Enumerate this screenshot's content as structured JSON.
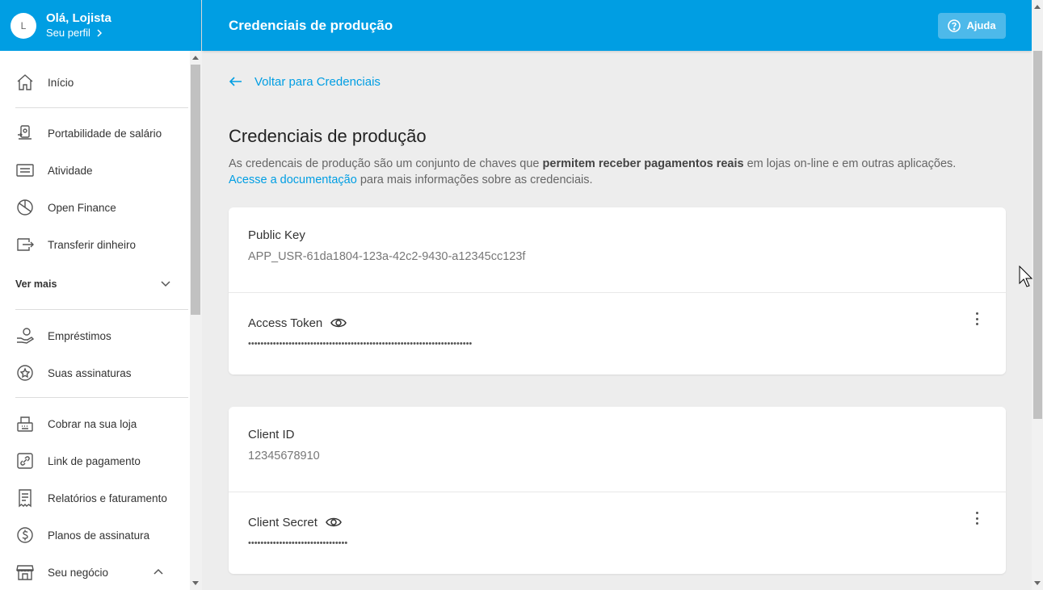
{
  "sidebar": {
    "avatar_initial": "L",
    "greeting": "Olá, Lojista",
    "profile_link": "Seu perfil",
    "items": [
      {
        "label": "Início",
        "icon": "home-icon"
      },
      {
        "label": "Portabilidade de salário",
        "icon": "salary-portability-icon"
      },
      {
        "label": "Atividade",
        "icon": "activity-icon"
      },
      {
        "label": "Open Finance",
        "icon": "open-finance-icon"
      },
      {
        "label": "Transferir dinheiro",
        "icon": "transfer-icon"
      },
      {
        "label": "Empréstimos",
        "icon": "loans-icon"
      },
      {
        "label": "Suas assinaturas",
        "icon": "subscriptions-icon"
      },
      {
        "label": "Cobrar na sua loja",
        "icon": "cash-register-icon"
      },
      {
        "label": "Link de pagamento",
        "icon": "payment-link-icon"
      },
      {
        "label": "Relatórios e faturamento",
        "icon": "reports-icon"
      },
      {
        "label": "Planos de assinatura",
        "icon": "subscription-plans-icon"
      },
      {
        "label": "Seu negócio",
        "icon": "store-icon"
      }
    ],
    "see_more": "Ver mais"
  },
  "header": {
    "title": "Credenciais de produção",
    "help_label": "Ajuda"
  },
  "main": {
    "back_link": "Voltar para Credenciais",
    "title": "Credenciais de produção",
    "intro_1": "As credencais de produção são um conjunto de chaves que ",
    "intro_bold": "permitem receber pagamentos reais",
    "intro_2": " em lojas on-line e em outras aplicações. ",
    "intro_link": "Acesse a documentação",
    "intro_3": " para mais informações sobre as credenciais.",
    "card1": {
      "public_key_label": "Public Key",
      "public_key_value": "APP_USR-61da1804-123a-42c2-9430-a12345cc123f",
      "access_token_label": "Access Token",
      "access_token_mask": "••••••••••••••••••••••••••••••••••••••••••••••••••••••••••••••••••••••••"
    },
    "card2": {
      "client_id_label": "Client ID",
      "client_id_value": "12345678910",
      "client_secret_label": "Client Secret",
      "client_secret_mask": "••••••••••••••••••••••••••••••••"
    }
  },
  "colors": {
    "brand": "#009ee3",
    "background": "#ededed"
  }
}
